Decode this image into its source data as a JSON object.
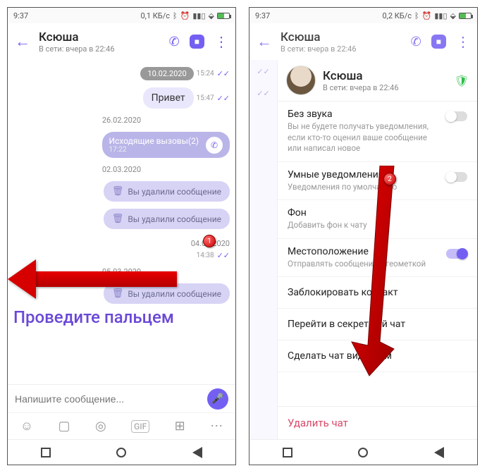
{
  "status": {
    "time": "9:37",
    "net": "0,1 КБ/с",
    "net2": "0,2 КБ/с"
  },
  "header": {
    "name": "Ксюша",
    "sub": "В сети: вчера в 22:46"
  },
  "chat": {
    "date1": "10.02.2020",
    "date1_time": "15:24",
    "msg1": "Привет",
    "msg1_time": "15:47",
    "date2": "26.02.2020",
    "call_label": "Исходящие вызовы(2)",
    "call_time": "17:22",
    "date3": "02.03.2020",
    "deleted": "Вы удалили сообщение",
    "date4": "04.03.2020",
    "time4": "14:38",
    "date5": "05.03.2020"
  },
  "input": {
    "placeholder": "Напишите сообщение..."
  },
  "overlay": {
    "swipe": "Проведите пальцем",
    "m1": "1",
    "m2": "2"
  },
  "sheet": {
    "name": "Ксюша",
    "sub": "В сети: вчера в 22:46",
    "mute_t": "Без звука",
    "mute_s": "Вы не будете получать уведомления, если кто-то оценил ваше сообщение или написал новое",
    "smart_t": "Умные уведомления",
    "smart_s": "Уведомления по умолчанию",
    "bg_t": "Фон",
    "bg_s": "Добавить фон к чату",
    "loc_t": "Местоположение",
    "loc_s": "Отправлять сообщения с геометкой",
    "block": "Заблокировать контакт",
    "secret": "Перейти в секретный чат",
    "visible": "Сделать чат видимым",
    "delete": "Удалить чат"
  }
}
